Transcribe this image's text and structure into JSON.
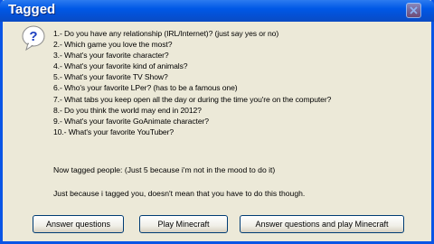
{
  "window": {
    "title": "Tagged"
  },
  "message": {
    "lines": [
      "1.- Do you have any relationship (IRL/Internet)? (just say yes or no)",
      "2.- Which game you love the most?",
      "3.- What's your favorite character?",
      "4.- What's your favorite kind of animals?",
      "5.- What's your favorite TV Show?",
      "6.- Who's your favorite LPer? (has to be a famous one)",
      "7.- What tabs you keep open all the day or during the time you're on the computer?",
      "8.- Do you think the world may end in 2012?",
      "9.- What's your favorite GoAnimate character?",
      "10.- What's your favorite YouTuber?"
    ],
    "note_tagged": "Now tagged people: (Just 5 because i'm not in the mood to do it)",
    "note_disclaimer": "Just because i tagged you, doesn't mean that you have to do this though."
  },
  "buttons": {
    "answer": "Answer questions",
    "play": "Play Minecraft",
    "both": "Answer questions and play Minecraft"
  },
  "icons": {
    "dialog": "question-icon",
    "close": "close-icon"
  }
}
